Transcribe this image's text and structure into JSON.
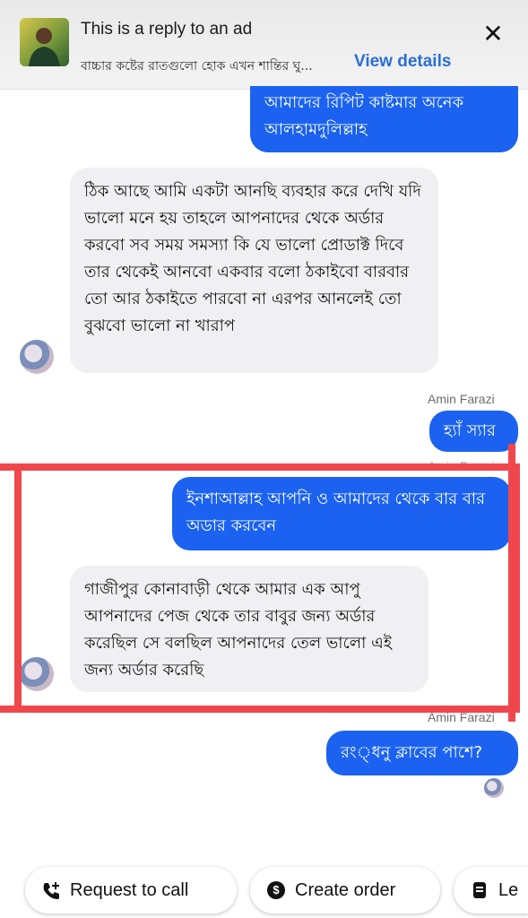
{
  "header": {
    "title": "This is a reply to an ad",
    "subtitle": "বাচ্চার কষ্টের রাতগুলো হোক এখন শান্তির ঘু...",
    "view_details": "View details"
  },
  "messages": [
    {
      "text": "আমাদের রিপিট কাষ্টমার অনেক আলহামদুলিল্লাহ"
    },
    {
      "text": "ঠিক আছে আমি একটা আনছি ব্যবহার করে দেখি যদি ভালো মনে হয় তাহলে আপনাদের থেকে অর্ডার করবো সব সময় সমস্যা কি যে ভালো প্রোডাক্ট দিবে তার থেকেই আনবো একবার বলো ঠকাইবো বারবার তো আর ঠকাইতে পারবো না এরপর আনলেই তো বুঝবো ভালো না খারাপ"
    },
    {
      "text": "হ্যাঁ স্যার"
    },
    {
      "text": "ইনশাআল্লাহ আপনি ও আমাদের থেকে বার বার অডার করবেন"
    },
    {
      "text": "গাজীপুর কোনাবাড়ী থেকে আমার এক আপু আপনাদের পেজ থেকে তার বাবুর জন্য অর্ডার করেছিল সে বলছিল আপনাদের তেল ভালো এই জন্য অর্ডার করেছি"
    },
    {
      "text": "রং্ধনু ক্লাবের পাশে?"
    }
  ],
  "senders": [
    "Amin Farazi",
    "Amin Farazi",
    "Amin Farazi"
  ],
  "actions": {
    "request_call": "Request to call",
    "create_order": "Create order",
    "third": "Le"
  },
  "colors": {
    "outgoing_bubble": "#1b62f0",
    "incoming_bubble": "#f0f0f2",
    "highlight": "#f0474c",
    "link": "#2a6fd6"
  },
  "icons": {
    "close": "close-icon",
    "call": "phone-plus-icon",
    "order": "dollar-circle-icon",
    "third": "document-icon"
  }
}
